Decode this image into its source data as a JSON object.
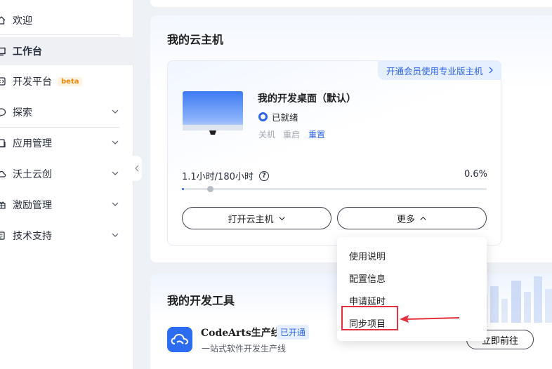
{
  "sidebar": {
    "items": [
      {
        "label": "欢迎",
        "icon": "home-icon"
      },
      {
        "label": "工作台",
        "icon": "workbench-icon",
        "active": true
      },
      {
        "label": "开发平台",
        "icon": "code-icon",
        "badge": "beta"
      },
      {
        "label": "探索",
        "icon": "chat-bubble-icon",
        "expandable": true
      },
      {
        "label": "应用管理",
        "icon": "app-manage-icon",
        "expandable": true
      },
      {
        "label": "沃土云创",
        "icon": "cloud-icon",
        "expandable": true
      },
      {
        "label": "激励管理",
        "icon": "gift-icon",
        "expandable": true
      },
      {
        "label": "技术支持",
        "icon": "support-icon",
        "expandable": true
      }
    ]
  },
  "cloud_host": {
    "title": "我的云主机",
    "promo": "开通会员使用专业版主机",
    "desktop_name": "我的开发桌面（默认）",
    "status": "已就绪",
    "actions": [
      "关机",
      "重启",
      "重置"
    ],
    "usage_text": "1.1小时/180小时",
    "usage_percent_label": "0.6%",
    "usage_fraction": 0.006,
    "open_button": "打开云主机",
    "more_button": "更多"
  },
  "more_menu": {
    "items": [
      "使用说明",
      "配置信息",
      "申请延时",
      "同步项目"
    ],
    "highlighted_index": 3
  },
  "dev_tools": {
    "title": "我的开发工具",
    "tool_name": "CodeArts生产线",
    "tool_badge": "已开通",
    "tool_desc": "一站式软件开发生产线",
    "goto_button": "立即前往"
  },
  "colors": {
    "accent": "#2c63e6",
    "highlight": "#e5303e",
    "beta": "#e8880d"
  }
}
